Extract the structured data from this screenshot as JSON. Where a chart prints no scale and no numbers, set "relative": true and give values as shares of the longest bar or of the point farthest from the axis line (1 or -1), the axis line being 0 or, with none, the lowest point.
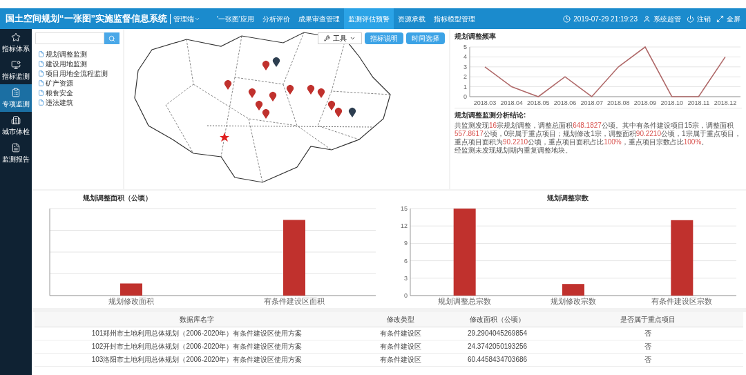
{
  "header": {
    "title": "国土空间规划“一张图”实施监督信息系统",
    "role": "管理端",
    "nav": [
      {
        "label": "'一张图'应用",
        "selected": false
      },
      {
        "label": "分析评价",
        "selected": false
      },
      {
        "label": "成果审查管理",
        "selected": false
      },
      {
        "label": "监测评估预警",
        "selected": true
      },
      {
        "label": "资源承载",
        "selected": false
      },
      {
        "label": "指标模型管理",
        "selected": false
      }
    ],
    "datetime": "2019-07-29  21:19:23",
    "user": "系统超管",
    "logout": "注销",
    "fullscreen": "全屏"
  },
  "sidebar": {
    "items": [
      {
        "label": "指标体系",
        "selected": false
      },
      {
        "label": "指标监测",
        "selected": false
      },
      {
        "label": "专项监测",
        "selected": true
      },
      {
        "label": "城市体检",
        "selected": false
      },
      {
        "label": "监测报告",
        "selected": false
      }
    ]
  },
  "tree": {
    "items": [
      "规划调整监测",
      "建设用地监测",
      "项目用地全流程监测",
      "矿产资源",
      "粮食安全",
      "违法建筑"
    ]
  },
  "map": {
    "tool": "工具",
    "buttons": [
      "指标说明",
      "时间选择"
    ]
  },
  "frequency": {
    "title": "规划调整频率",
    "chart_data": {
      "type": "line",
      "categories": [
        "2018.03",
        "2018.04",
        "2018.05",
        "2018.06",
        "2018.07",
        "2018.08",
        "2018.09",
        "2018.10",
        "2018.11",
        "2018.12"
      ],
      "series": [
        {
          "color": "#b06a6a",
          "values": [
            3,
            1,
            0,
            2,
            0,
            3,
            5,
            0,
            0,
            4
          ]
        }
      ],
      "ylim": [
        0,
        5
      ],
      "yticks": [
        0,
        1,
        2,
        3,
        4,
        5
      ],
      "grid": true
    }
  },
  "analysis": {
    "title": "规划调整监测分析结论:",
    "paragraph": [
      {
        "text": "共监测发现",
        "highlight": false
      },
      {
        "text": "16",
        "highlight": true
      },
      {
        "text": "宗规划调整，调整总面积",
        "highlight": false
      },
      {
        "text": "648.1827",
        "highlight": true
      },
      {
        "text": "公顷。其中有条件建设项目15宗，调整面积",
        "highlight": false
      },
      {
        "text": "557.8617",
        "highlight": true
      },
      {
        "text": "公顷，0宗属于重点项目；规划修改1宗，调整面积",
        "highlight": false
      },
      {
        "text": "90.2210",
        "highlight": true
      },
      {
        "text": "公顷，1宗属于重点项目，重点项目面积为",
        "highlight": false
      },
      {
        "text": "90.2210",
        "highlight": true
      },
      {
        "text": "公顷，重点项目面积占比",
        "highlight": false
      },
      {
        "text": "100%",
        "highlight": true
      },
      {
        "text": "，重点项目宗数占比",
        "highlight": false
      },
      {
        "text": "100%",
        "highlight": true
      },
      {
        "text": "。",
        "highlight": false
      }
    ],
    "note": "经监测未发现规划期内重复调整地块。"
  },
  "area_chart": {
    "title": "规划调整面积（公顷）",
    "chart_data": {
      "type": "bar",
      "relative": true,
      "categories": [
        "规划修改面积",
        "有条件建设区面积"
      ],
      "series": [
        {
          "color": "#c0312d",
          "values": [
            0.16,
            1
          ]
        }
      ],
      "grid": true
    }
  },
  "count_chart": {
    "title": "规划调整宗数",
    "chart_data": {
      "type": "bar",
      "categories": [
        "规划调整总宗数",
        "规划修改宗数",
        "有条件建设区宗数"
      ],
      "series": [
        {
          "color": "#c0312d",
          "values": [
            15,
            2,
            13
          ]
        }
      ],
      "ylim": [
        0,
        15
      ],
      "yticks": [
        0,
        3,
        6,
        9,
        12,
        15
      ],
      "grid": true
    }
  },
  "table": {
    "columns": [
      "数据库名字",
      "修改类型",
      "修改面积（公顷）",
      "是否属于重点项目"
    ],
    "rows": [
      [
        "101郑州市土地利用总体规划（2006-2020年）有条件建设区使用方案",
        "有条件建设区",
        "29.2904045269854",
        "否"
      ],
      [
        "102开封市土地利用总体规划（2006-2020年）有条件建设区使用方案",
        "有条件建设区",
        "24.3742050193256",
        "否"
      ],
      [
        "103洛阳市土地利用总体规划（2006-2020年）有条件建设区使用方案",
        "有条件建设区",
        "60.4458434703686",
        "否"
      ]
    ]
  }
}
